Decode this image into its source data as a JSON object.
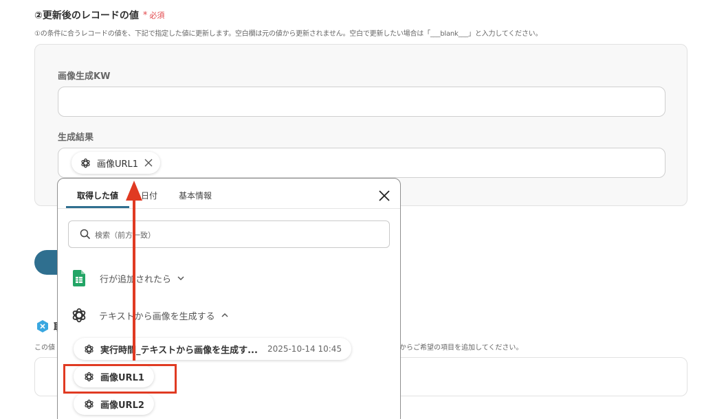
{
  "section": {
    "title": "②更新後のレコードの値",
    "required_star": "*",
    "required_label": "必須",
    "description": "①の条件に合うレコードの値を、下記で指定した値に更新します。空白欄は元の値から更新されません。空白で更新したい場合は「___blank___」と入力してください。"
  },
  "fields": [
    {
      "label": "画像生成KW",
      "value": ""
    },
    {
      "label": "生成結果"
    }
  ],
  "selected_chip": {
    "label": "画像URL1"
  },
  "background_text": {
    "hidden_heading_fragment": "取",
    "hidden_desc_left": "この値",
    "hidden_desc_right": "からご希望の項目を追加してください。"
  },
  "dropdown": {
    "tabs": [
      {
        "label": "取得した値",
        "active": true
      },
      {
        "label": "日付",
        "active": false
      },
      {
        "label": "基本情報",
        "active": false
      }
    ],
    "search_placeholder": "検索（前方一致）",
    "groups": [
      {
        "label": "行が追加されたら",
        "icon": "google-sheets-icon",
        "expanded": false
      },
      {
        "label": "テキストから画像を生成する",
        "icon": "openai-icon",
        "expanded": true
      }
    ],
    "items": [
      {
        "label": "実行時間_テキストから画像を生成す...",
        "time": "2025-10-14 10:45"
      },
      {
        "label": "画像URL1"
      },
      {
        "label": "画像URL2"
      }
    ]
  },
  "colors": {
    "accent": "#2f6f8f",
    "required": "#e2474b",
    "annotation": "#e03a22",
    "sheets_green": "#23a566"
  }
}
